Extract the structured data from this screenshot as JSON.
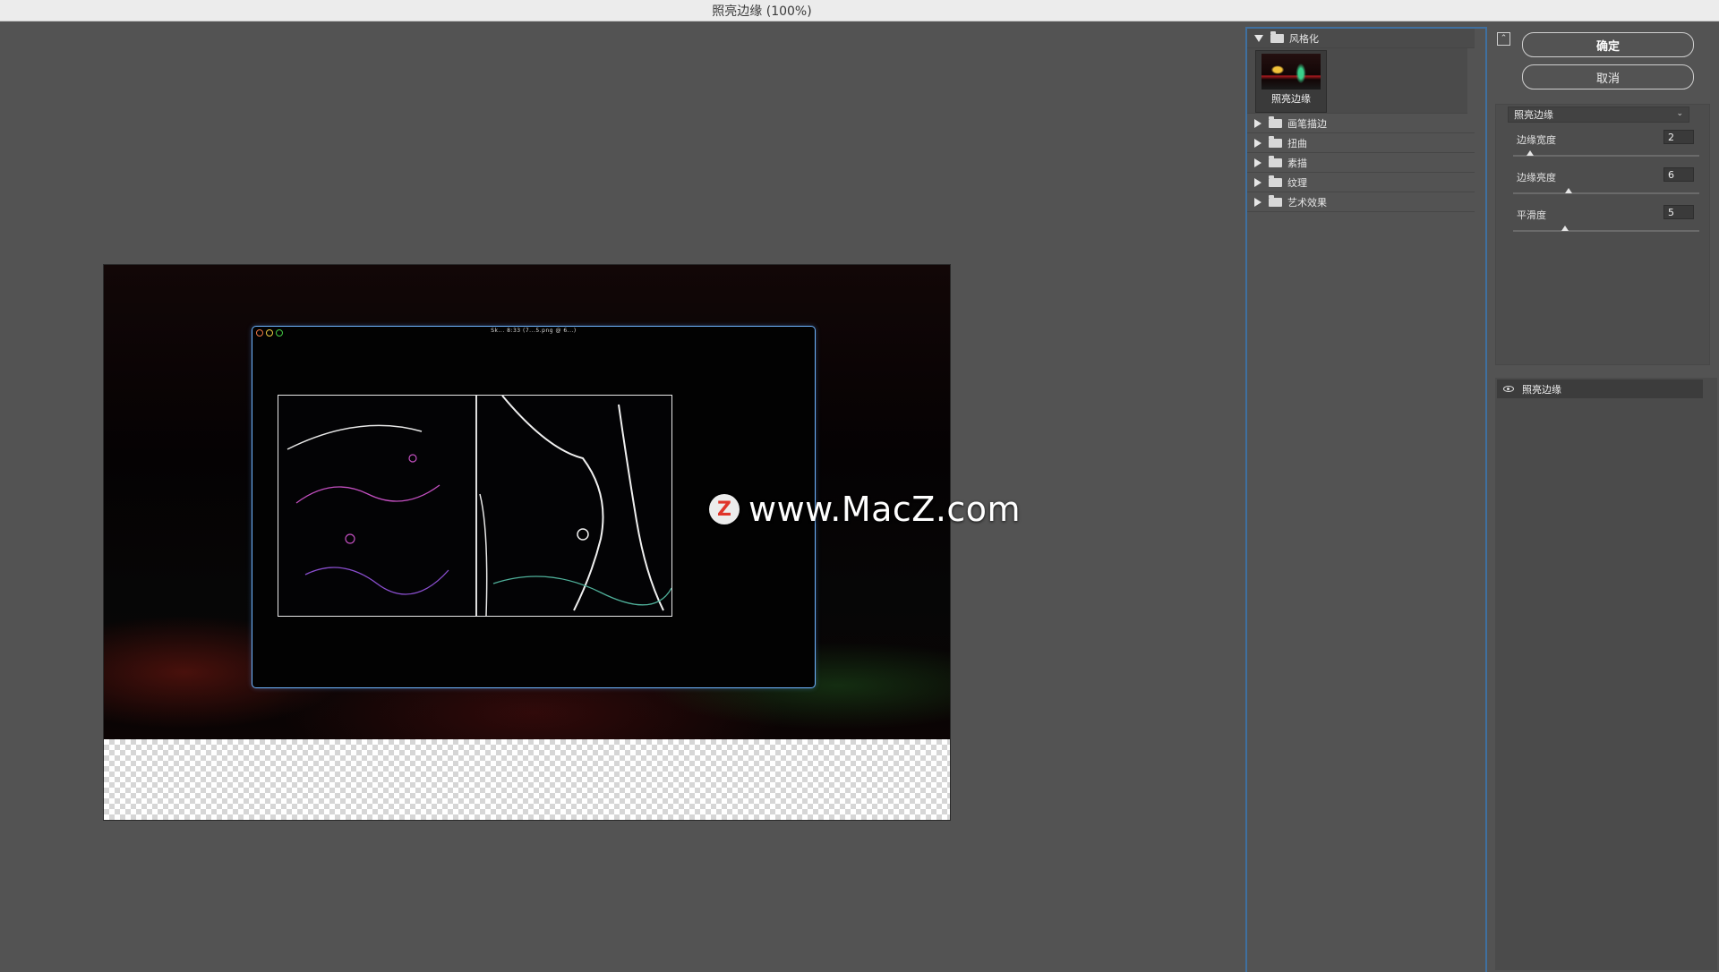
{
  "window": {
    "title": "照亮边缘 (100%)"
  },
  "preview": {
    "inner_window_title": "Sk... 8:33 (7...5.png @ 6...)",
    "watermark": {
      "badge": "Z",
      "text": "www.MacZ.com"
    }
  },
  "gallery": {
    "expanded_category": "风格化",
    "selected_filter": {
      "label": "照亮边缘"
    },
    "categories": [
      "画笔描边",
      "扭曲",
      "素描",
      "纹理",
      "艺术效果"
    ]
  },
  "actions": {
    "ok_label": "确定",
    "cancel_label": "取消",
    "collapse_icon": "double-chevron-up-icon"
  },
  "settings": {
    "filter_select": "照亮边缘",
    "params": [
      {
        "label": "边缘宽度",
        "value": "2",
        "fraction": 0.09
      },
      {
        "label": "边缘亮度",
        "value": "6",
        "fraction": 0.3
      },
      {
        "label": "平滑度",
        "value": "5",
        "fraction": 0.28
      }
    ]
  },
  "layers": {
    "items": [
      {
        "label": "照亮边缘",
        "visible": true
      }
    ]
  }
}
